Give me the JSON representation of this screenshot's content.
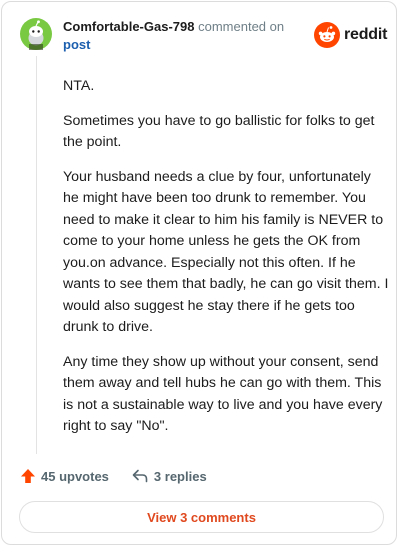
{
  "comment": {
    "author": "Comfortable-Gas-798",
    "action": "commented on",
    "post_link": "post",
    "paragraphs": [
      "NTA.",
      "Sometimes you have to go ballistic for folks to get the point.",
      "Your husband needs a clue by four, unfortunately he might have been too drunk to remember. You need to make it clear to him his family is NEVER to come to your home unless he gets the OK from you.on advance. Especially not this often. If he wants to see them that badly, he can go visit them. I would also suggest he stay there if he gets too drunk to drive.",
      "Any time they show up without your consent, send them away and tell hubs he can go with them. This is not a sustainable way to live and you have every right to say \"No\"."
    ]
  },
  "brand": {
    "name": "reddit"
  },
  "actions": {
    "upvotes": "45 upvotes",
    "replies": "3 replies",
    "view_comments": "View 3 comments"
  },
  "colors": {
    "upvote": "#ff4500",
    "link": "#1c5fae",
    "avatar_bg": "#7ac943",
    "view_button_text": "#e0491f"
  },
  "icons": [
    "avatar-snoo-icon",
    "reddit-logo-icon",
    "upvote-arrow-icon",
    "reply-arrow-icon"
  ]
}
